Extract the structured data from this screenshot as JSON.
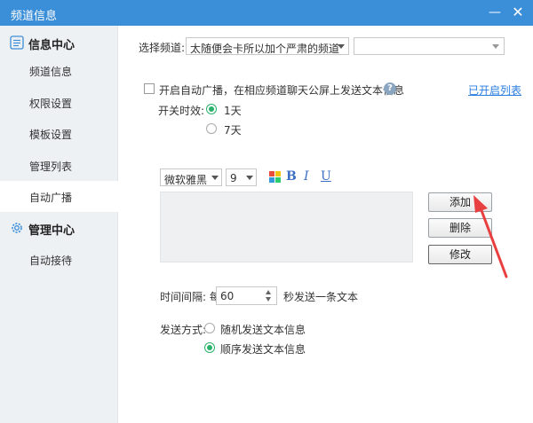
{
  "window": {
    "title": "频道信息",
    "minimize_glyph": "—",
    "close_glyph": "✕"
  },
  "sidebar": {
    "section_info": "信息中心",
    "section_manage": "管理中心",
    "items": [
      {
        "label": "频道信息"
      },
      {
        "label": "权限设置"
      },
      {
        "label": "模板设置"
      },
      {
        "label": "管理列表"
      },
      {
        "label": "自动广播"
      },
      {
        "label": "自动接待"
      }
    ]
  },
  "channel": {
    "label": "选择频道:",
    "selected": "太随便会卡所以加个严肃的频道",
    "second_selected": ""
  },
  "broadcast": {
    "enable_label": "开启自动广播，在相应频道聊天公屏上发送文本信息",
    "enabled": false,
    "help_glyph": "?",
    "opened_list_link": "已开启列表",
    "validity_label": "开关时效:",
    "option_1day": "1天",
    "option_7day": "7天",
    "selected_validity": "1天"
  },
  "editor": {
    "font": "微软雅黑",
    "size": "9",
    "bold": "B",
    "italic": "I",
    "underline": "U",
    "text": ""
  },
  "buttons": {
    "add": "添加",
    "delete": "删除",
    "modify": "修改"
  },
  "interval": {
    "label": "时间间隔: 每",
    "value": "60",
    "suffix": "秒发送一条文本"
  },
  "send_mode": {
    "label": "发送方式:",
    "random": "随机发送文本信息",
    "sequential": "顺序发送文本信息",
    "selected": "顺序发送文本信息"
  },
  "colors": {
    "titlebar": "#3b8ed8",
    "radio_on": "#27b16a",
    "link": "#2a7de1",
    "annotation_arrow": "#e84040"
  }
}
